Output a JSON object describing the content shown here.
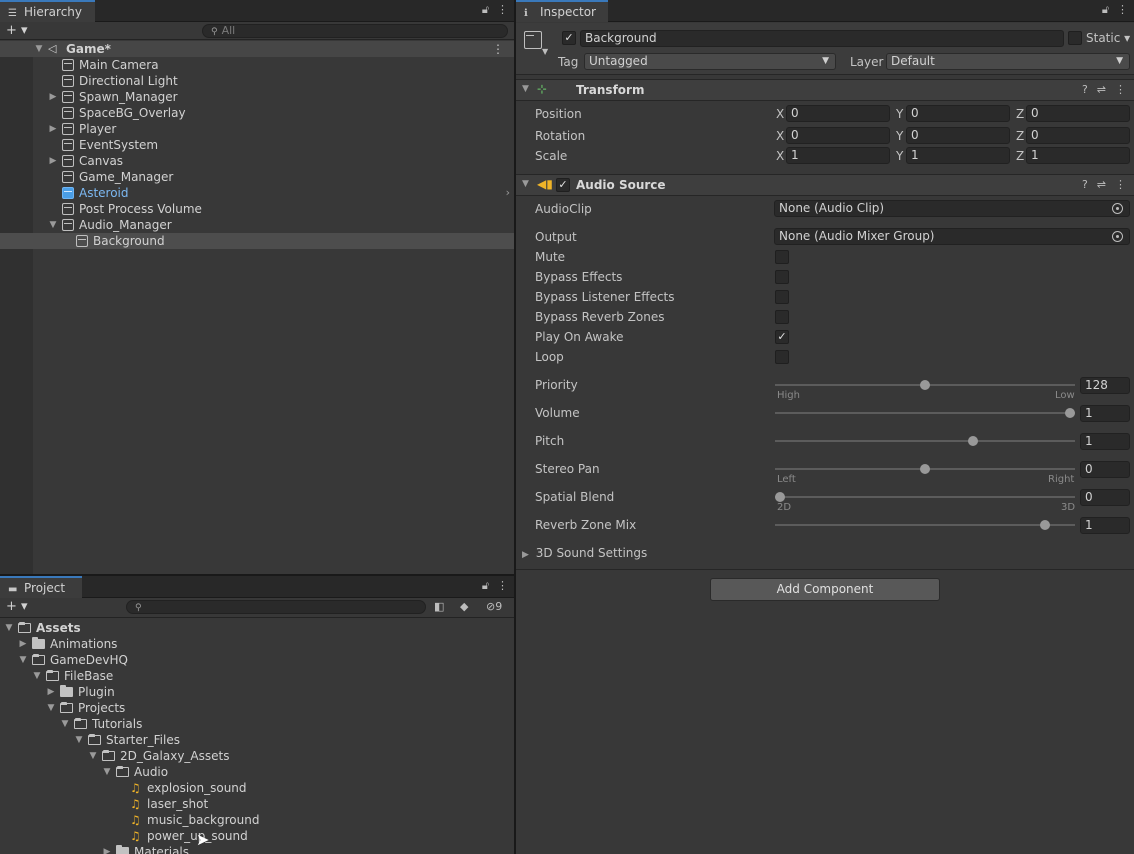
{
  "hierarchy": {
    "tab_label": "Hierarchy",
    "search_placeholder": "All",
    "scene_name": "Game*",
    "items": [
      {
        "label": "Main Camera"
      },
      {
        "label": "Directional Light"
      },
      {
        "label": "Spawn_Manager"
      },
      {
        "label": "SpaceBG_Overlay"
      },
      {
        "label": "Player"
      },
      {
        "label": "EventSystem"
      },
      {
        "label": "Canvas"
      },
      {
        "label": "Game_Manager"
      },
      {
        "label": "Asteroid"
      },
      {
        "label": "Post Process Volume"
      },
      {
        "label": "Audio_Manager"
      },
      {
        "label": "Background"
      }
    ]
  },
  "project": {
    "tab_label": "Project",
    "hidden_count": "9",
    "items": [
      {
        "label": "Assets"
      },
      {
        "label": "Animations"
      },
      {
        "label": "GameDevHQ"
      },
      {
        "label": "FileBase"
      },
      {
        "label": "Plugin"
      },
      {
        "label": "Projects"
      },
      {
        "label": "Tutorials"
      },
      {
        "label": "Starter_Files"
      },
      {
        "label": "2D_Galaxy_Assets"
      },
      {
        "label": "Audio"
      },
      {
        "label": "explosion_sound"
      },
      {
        "label": "laser_shot"
      },
      {
        "label": "music_background"
      },
      {
        "label": "power_up_sound"
      },
      {
        "label": "Materials"
      }
    ]
  },
  "inspector": {
    "tab_label": "Inspector",
    "object_name": "Background",
    "static_label": "Static",
    "tag_label": "Tag",
    "tag_value": "Untagged",
    "layer_label": "Layer",
    "layer_value": "Default",
    "transform": {
      "title": "Transform",
      "position_label": "Position",
      "rotation_label": "Rotation",
      "scale_label": "Scale",
      "axis_x": "X",
      "axis_y": "Y",
      "axis_z": "Z",
      "position": [
        "0",
        "0",
        "0"
      ],
      "rotation": [
        "0",
        "0",
        "0"
      ],
      "scale": [
        "1",
        "1",
        "1"
      ]
    },
    "audio_source": {
      "title": "Audio Source",
      "audioclip_label": "AudioClip",
      "audioclip_value": "None (Audio Clip)",
      "output_label": "Output",
      "output_value": "None (Audio Mixer Group)",
      "mute_label": "Mute",
      "bypass_effects_label": "Bypass Effects",
      "bypass_listener_label": "Bypass Listener Effects",
      "bypass_reverb_label": "Bypass Reverb Zones",
      "play_on_awake_label": "Play On Awake",
      "loop_label": "Loop",
      "check_mark": "✓",
      "priority": {
        "label": "Priority",
        "value": "128",
        "fraction": 0.5,
        "min_label": "High",
        "max_label": "Low"
      },
      "volume": {
        "label": "Volume",
        "value": "1",
        "fraction": 1.0
      },
      "pitch": {
        "label": "Pitch",
        "value": "1",
        "fraction": 0.66
      },
      "stereo_pan": {
        "label": "Stereo Pan",
        "value": "0",
        "fraction": 0.5,
        "min_label": "Left",
        "max_label": "Right"
      },
      "spatial_blend": {
        "label": "Spatial Blend",
        "value": "0",
        "fraction": 0.0,
        "min_label": "2D",
        "max_label": "3D"
      },
      "reverb_zone_mix": {
        "label": "Reverb Zone Mix",
        "value": "1",
        "fraction": 0.9
      },
      "sound_settings_label": "3D Sound Settings"
    },
    "add_component_label": "Add Component"
  },
  "icons": [
    "hierarchy-list-icon",
    "lock-icon",
    "kebab-menu-icon",
    "search-icon",
    "unity-scene-icon",
    "gameobject-cube-icon",
    "folder-icon",
    "audio-file-icon",
    "transform-icon",
    "speaker-icon",
    "help-icon",
    "presets-icon"
  ],
  "colors": {
    "accent_tab": "#3a79bb",
    "prefab_blue": "#6fb5f5",
    "audio_icon": "#f0b428"
  }
}
